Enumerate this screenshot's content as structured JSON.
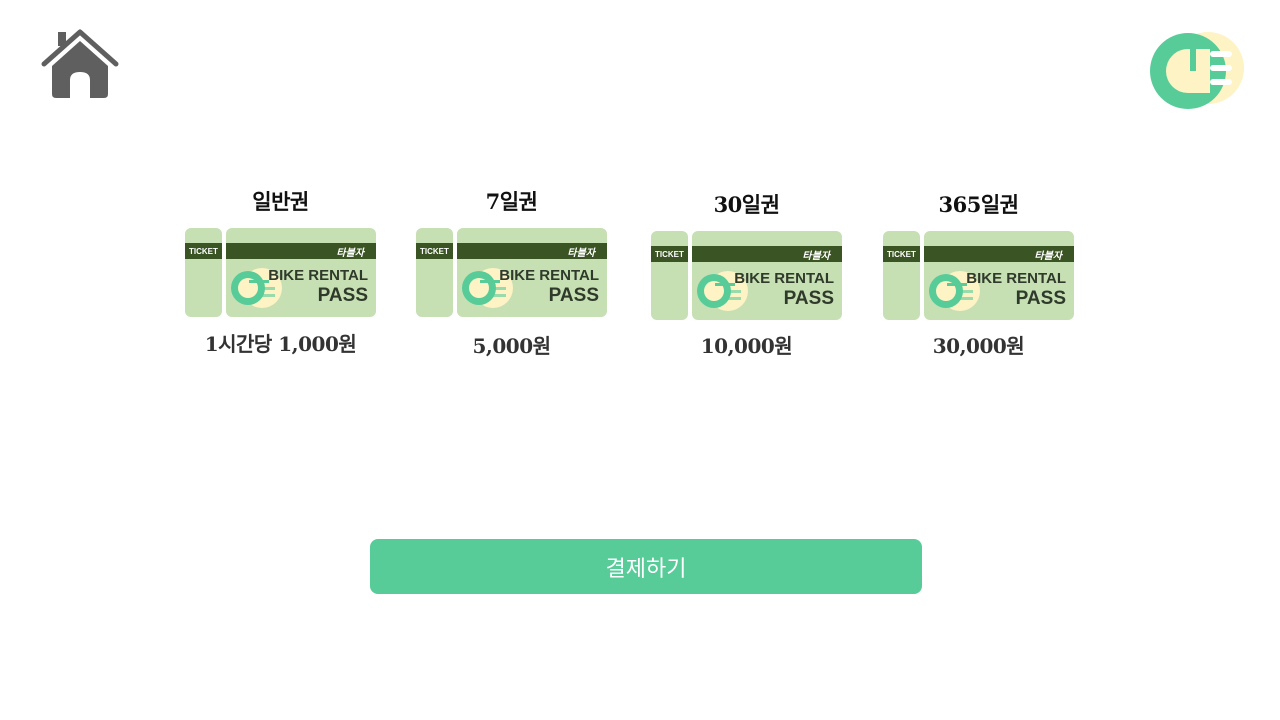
{
  "header": {
    "home_icon": "home-icon",
    "logo_icon": "brand-logo-icon"
  },
  "passes": [
    {
      "title": "일반권",
      "price": "1시간당 1,000원",
      "stub": "TICKET",
      "band": "타블자",
      "line1": "BIKE RENTAL",
      "line2": "PASS"
    },
    {
      "title": "7일권",
      "price": "5,000원",
      "stub": "TICKET",
      "band": "타블자",
      "line1": "BIKE RENTAL",
      "line2": "PASS"
    },
    {
      "title": "30일권",
      "price": "10,000원",
      "stub": "TICKET",
      "band": "타블자",
      "line1": "BIKE RENTAL",
      "line2": "PASS"
    },
    {
      "title": "365일권",
      "price": "30,000원",
      "stub": "TICKET",
      "band": "타블자",
      "line1": "BIKE RENTAL",
      "line2": "PASS"
    }
  ],
  "actions": {
    "pay_label": "결제하기"
  },
  "colors": {
    "accent": "#57cc99",
    "ticket_bg": "#c6e0b4",
    "ticket_band": "#3a5423",
    "logo_cream": "#fdf3c4",
    "icon_gray": "#5f5f5f"
  }
}
